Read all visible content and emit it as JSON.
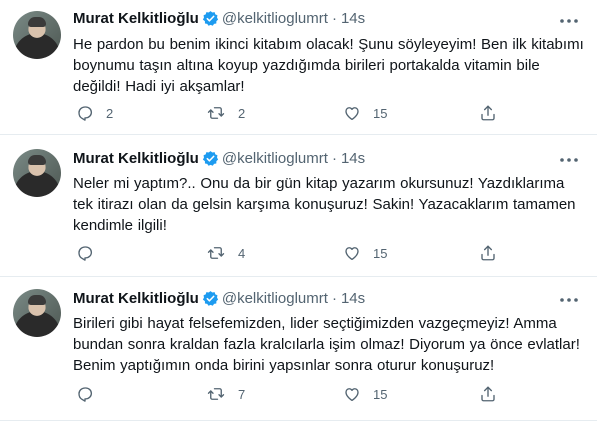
{
  "tweets": [
    {
      "name": "Murat Kelkitlioğlu",
      "handle": "@kelkitlioglumrt",
      "dot": "·",
      "time": "14s",
      "text": "He pardon bu benim ikinci kitabım olacak! Şunu söyleyeyim! Ben ilk kitabımı boynumu taşın altına koyup yazdığımda birileri portakalda vitamin bile değildi! Hadi iyi akşamlar!",
      "replies": "2",
      "retweets": "2",
      "likes": "15"
    },
    {
      "name": "Murat Kelkitlioğlu",
      "handle": "@kelkitlioglumrt",
      "dot": "·",
      "time": "14s",
      "text": "Neler mi yaptım?.. Onu da bir gün kitap yazarım okursunuz! Yazdıklarıma tek itirazı olan da gelsin karşıma konuşuruz! Sakin! Yazacaklarım tamamen kendimle ilgili!",
      "replies": "",
      "retweets": "4",
      "likes": "15"
    },
    {
      "name": "Murat Kelkitlioğlu",
      "handle": "@kelkitlioglumrt",
      "dot": "·",
      "time": "14s",
      "text": "Birileri gibi hayat felsefemizden, lider seçtiğimizden vazgeçmeyiz! Amma bundan sonra kraldan fazla kralcılarla işim olmaz! Diyorum ya önce evlatlar! Benim yaptığımın onda birini yapsınlar sonra oturur konuşuruz!",
      "replies": "",
      "retweets": "7",
      "likes": "15"
    }
  ],
  "icons": {
    "verified": "verified-badge-icon",
    "more": "more-options-icon",
    "reply": "reply-icon",
    "retweet": "retweet-icon",
    "like": "like-icon",
    "share": "share-icon"
  },
  "colors": {
    "verified": "#1d9bf0",
    "secondary_text": "#536471",
    "divider": "#e6ecf0"
  }
}
